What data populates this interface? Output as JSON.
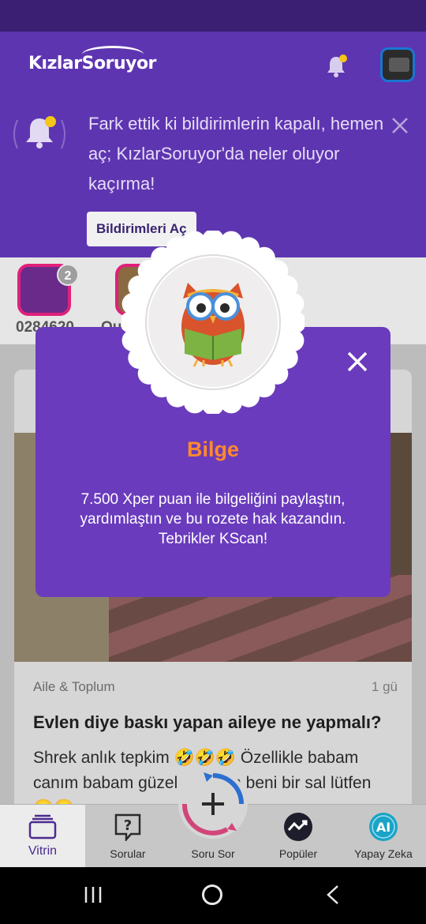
{
  "header": {
    "logo_text": "KızlarSoruyor",
    "brand_color": "#5e35b1",
    "accent_dot_color": "#f5c518"
  },
  "notification_banner": {
    "message": "Fark ettik ki bildirimlerin kapalı, hemen aç; KızlarSoruyor'da neler oluyor kaçırma!",
    "button_label": "Bildirimleri Aç",
    "close_icon": "close-icon"
  },
  "stories": [
    {
      "label": "0284620",
      "count": "2"
    },
    {
      "label": "Ou"
    }
  ],
  "card": {
    "category": "Aile & Toplum",
    "time": "1 gü",
    "title": "Evlen diye baskı yapan aileye ne yapmalı?",
    "body": "Shrek anlık tepkim 🤣🤣🤣 Özellikle babam canım babam güzel ... n sen beni bir sal lütfen 🥲🥲 ..."
  },
  "bottom_nav": {
    "items": [
      {
        "label": "Vitrin",
        "icon": "cards-icon",
        "active": true
      },
      {
        "label": "Sorular",
        "icon": "question-icon"
      },
      {
        "label": "Soru Sor",
        "icon": "plus-icon"
      },
      {
        "label": "Popüler",
        "icon": "trending-icon"
      },
      {
        "label": "Yapay Zeka",
        "icon": "ai-icon"
      }
    ]
  },
  "modal": {
    "badge_name": "Bilge",
    "description": "7.500 Xper puan ile bilgeliğini paylaştın, yardımlaştın ve bu rozete hak kazandın. Tebrikler KScan!",
    "badge_icon": "owl-icon",
    "background_color": "#6a3bbd",
    "title_color": "#ff8a2b"
  }
}
